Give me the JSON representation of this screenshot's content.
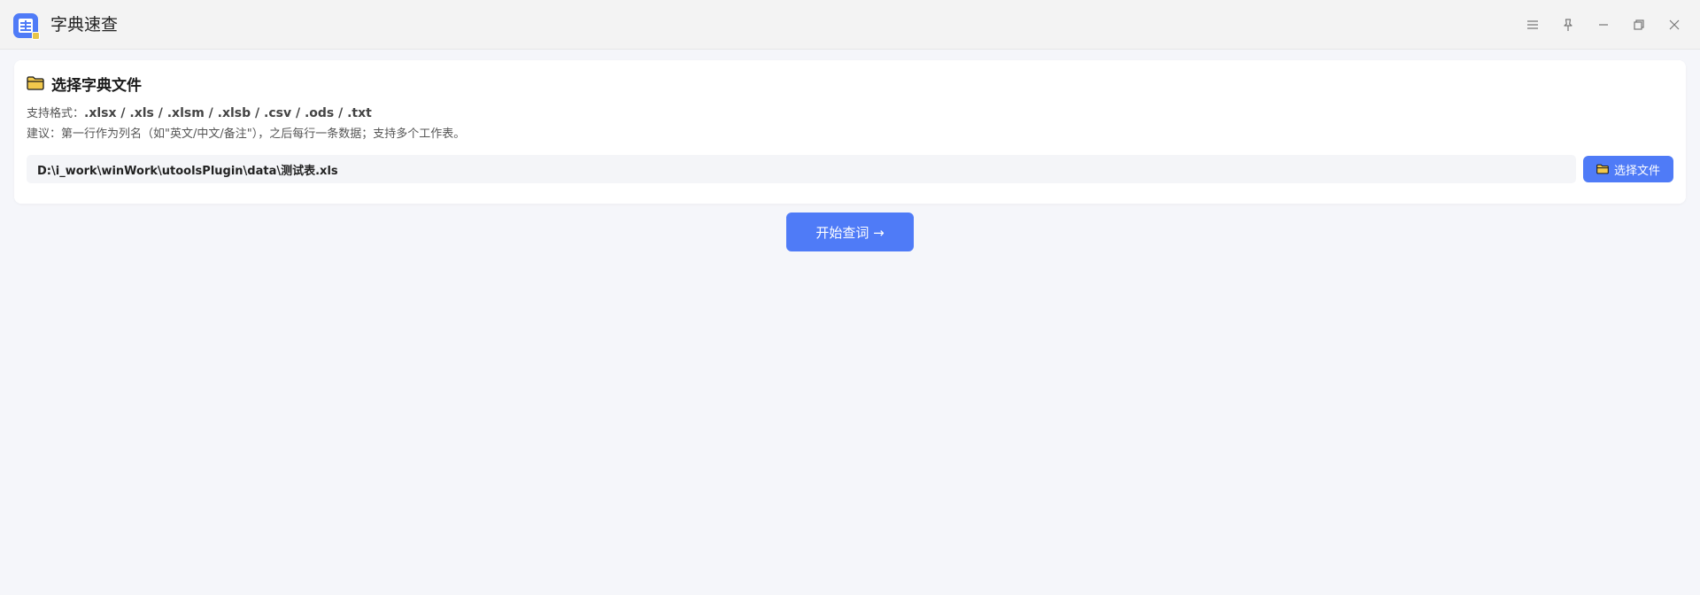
{
  "window": {
    "title": "字典速查",
    "controls": [
      "menu-icon",
      "pin-icon",
      "minimize-icon",
      "restore-icon",
      "close-icon"
    ]
  },
  "card": {
    "title": "选择字典文件",
    "formats_label": "支持格式：",
    "formats_value": ".xlsx / .xls / .xlsm / .xlsb / .csv / .ods / .txt",
    "hint": "建议：第一行作为列名（如\"英文/中文/备注\"），之后每行一条数据；支持多个工作表。",
    "file_path": "D:\\i_work\\winWork\\utoolsPlugin\\data\\测试表.xls",
    "pick_button": "选择文件"
  },
  "start_button": "开始查词 →",
  "colors": {
    "accent": "#4f7bf7",
    "background": "#f5f6fa",
    "folder": "#f2c94c"
  }
}
